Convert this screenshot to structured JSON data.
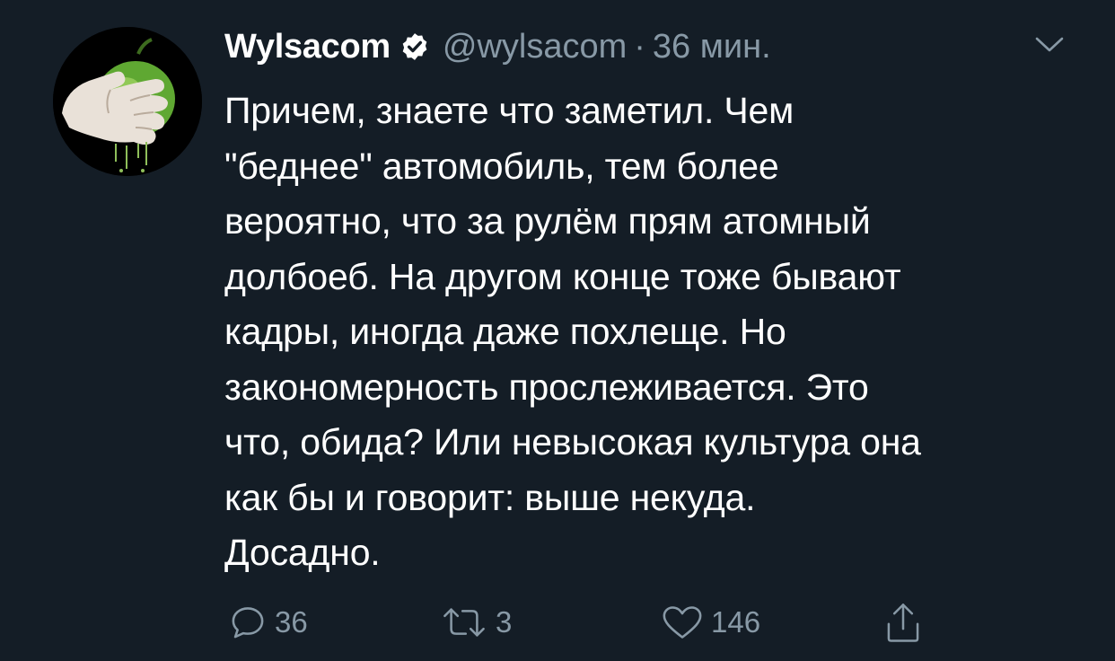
{
  "tweet": {
    "author_name": "Wylsacom",
    "author_handle": "@wylsacom",
    "separator": "·",
    "time": "36 мин.",
    "verified": true,
    "avatar_icon": "avatar-hand-squeezing-apple",
    "text_lines": [
      "Причем, знаете что заметил. Чем",
      "\"беднее\" автомобиль, тем более",
      "вероятно, что за рулём прям атомный",
      "долбоеб. На другом конце тоже бывают",
      "кадры, иногда даже похлеще. Но",
      "закономерность прослеживается. Это",
      "что, обида? Или невысокая культура она",
      "как бы и говорит: выше некуда.",
      "Досадно."
    ]
  },
  "actions": {
    "reply_count": "36",
    "retweet_count": "3",
    "like_count": "146",
    "share_icon": "share-icon"
  },
  "colors": {
    "background": "#141d26",
    "text_primary": "#ffffff",
    "text_secondary": "#8899a6"
  }
}
